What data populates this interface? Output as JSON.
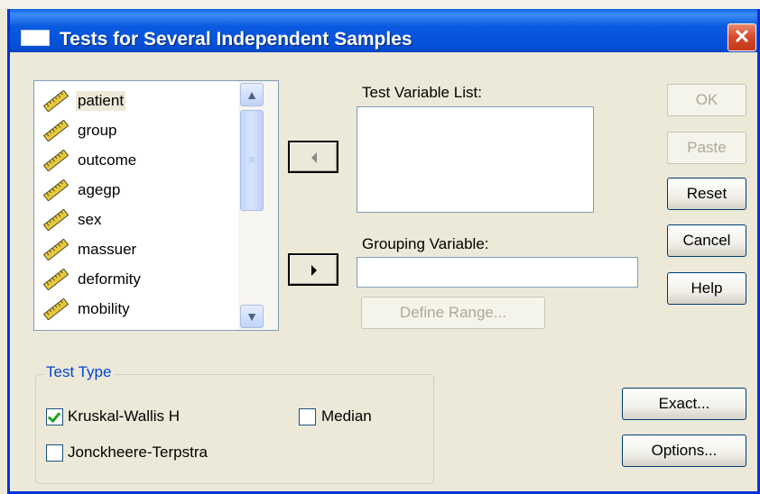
{
  "window": {
    "title": "Tests for Several Independent Samples",
    "close_glyph": "✕"
  },
  "variables": [
    "patient",
    "group",
    "outcome",
    "agegp",
    "sex",
    "massuer",
    "deformity",
    "mobility"
  ],
  "selected_variable": "patient",
  "test_variable_list": {
    "label": "Test Variable List:",
    "items": []
  },
  "grouping_variable": {
    "label": "Grouping Variable:",
    "value": ""
  },
  "buttons": {
    "ok": "OK",
    "paste": "Paste",
    "reset": "Reset",
    "cancel": "Cancel",
    "help": "Help",
    "define_range": "Define Range...",
    "exact": "Exact...",
    "options": "Options..."
  },
  "test_type": {
    "title": "Test Type",
    "kruskal_wallis": {
      "label": "Kruskal-Wallis H",
      "checked": true
    },
    "median": {
      "label": "Median",
      "checked": false
    },
    "jonckheere": {
      "label": "Jonckheere-Terpstra",
      "checked": false
    }
  },
  "icons": {
    "variable": "ruler-scale-icon",
    "scroll_up": "chevron-up-icon",
    "scroll_down": "chevron-down-icon",
    "move_left": "arrow-left-icon",
    "move_right": "arrow-right-icon"
  },
  "colors": {
    "titlebar": "#0550d8",
    "dialog_bg": "#ece9d8",
    "group_title": "#0046d5",
    "check": "#21a121"
  }
}
